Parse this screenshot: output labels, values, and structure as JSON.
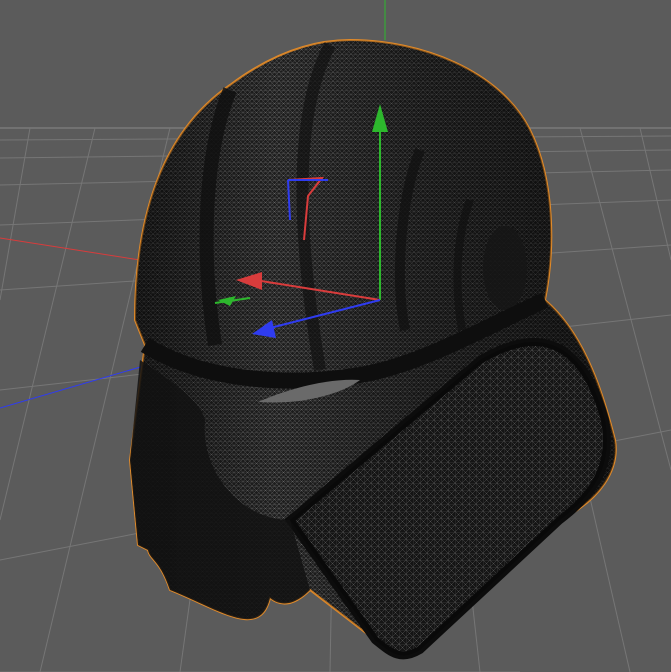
{
  "viewport": {
    "background": "#5b5b5b",
    "grid_color": "#777777",
    "horizon_color": "#8a8a8a",
    "axis_colors": {
      "x": "#d83c3c",
      "y": "#2db82d",
      "z": "#2f3cf0"
    }
  },
  "object": {
    "kind": "helmet-mesh",
    "display_mode": "wireframe-shaded",
    "mesh_color": "#1c1c1c",
    "wire_color": "#9a9a9a",
    "selection_outline_color": "#e08a2a",
    "selected": true
  },
  "gizmo": {
    "type": "move-manipulator",
    "axes": [
      "x",
      "y",
      "z"
    ]
  }
}
